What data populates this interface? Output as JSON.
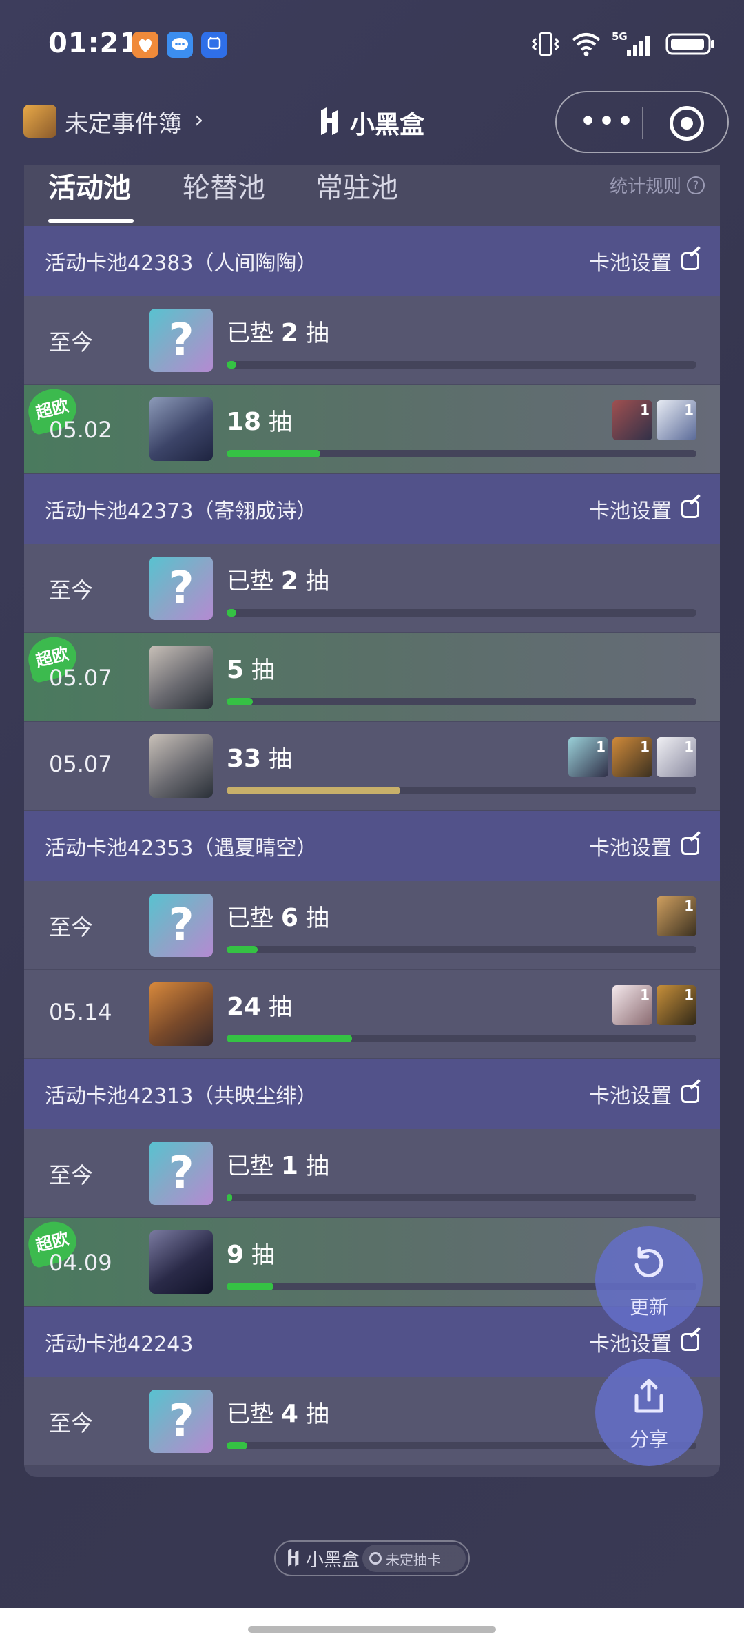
{
  "status_bar": {
    "time": "01:21",
    "network": "5G"
  },
  "nav": {
    "app_name": "未定事件簿",
    "brand": "小黑盒"
  },
  "tabs": [
    {
      "label": "活动池",
      "active": true
    },
    {
      "label": "轮替池",
      "active": false
    },
    {
      "label": "常驻池",
      "active": false
    }
  ],
  "rules_label": "统计规则",
  "pools": [
    {
      "title": "活动卡池42383（人间陶陶）",
      "settings_label": "卡池设置",
      "rows": [
        {
          "date": "至今",
          "prefix": "已垫",
          "count": "2",
          "unit": "抽",
          "lucky": false,
          "progress": 0.02
        },
        {
          "date": "05.02",
          "prefix": "",
          "count": "18",
          "unit": "抽",
          "lucky": true,
          "badge": "超欧",
          "progress": 0.2,
          "minis": [
            "1",
            "1"
          ]
        }
      ]
    },
    {
      "title": "活动卡池42373（寄翎成诗）",
      "settings_label": "卡池设置",
      "rows": [
        {
          "date": "至今",
          "prefix": "已垫",
          "count": "2",
          "unit": "抽",
          "lucky": false,
          "progress": 0.02
        },
        {
          "date": "05.07",
          "prefix": "",
          "count": "5",
          "unit": "抽",
          "lucky": true,
          "badge": "超欧",
          "progress": 0.055
        },
        {
          "date": "05.07",
          "prefix": "",
          "count": "33",
          "unit": "抽",
          "lucky": false,
          "progress": 0.37,
          "gold": true,
          "minis": [
            "1",
            "1",
            "1"
          ]
        }
      ]
    },
    {
      "title": "活动卡池42353（遇夏晴空）",
      "settings_label": "卡池设置",
      "rows": [
        {
          "date": "至今",
          "prefix": "已垫",
          "count": "6",
          "unit": "抽",
          "lucky": false,
          "progress": 0.066,
          "minis": [
            "1"
          ]
        },
        {
          "date": "05.14",
          "prefix": "",
          "count": "24",
          "unit": "抽",
          "lucky": false,
          "progress": 0.267,
          "minis": [
            "1",
            "1"
          ]
        }
      ]
    },
    {
      "title": "活动卡池42313（共映尘绯）",
      "settings_label": "卡池设置",
      "rows": [
        {
          "date": "至今",
          "prefix": "已垫",
          "count": "1",
          "unit": "抽",
          "lucky": false,
          "progress": 0.01
        },
        {
          "date": "04.09",
          "prefix": "",
          "count": "9",
          "unit": "抽",
          "lucky": true,
          "badge": "超欧",
          "progress": 0.1
        }
      ]
    },
    {
      "title": "活动卡池42243",
      "settings_label": "卡池设置",
      "rows": [
        {
          "date": "至今",
          "prefix": "已垫",
          "count": "4",
          "unit": "抽",
          "lucky": false,
          "progress": 0.044
        }
      ]
    }
  ],
  "fab": {
    "refresh_label": "更新",
    "share_label": "分享"
  },
  "footer": {
    "brand": "小黑盒",
    "tag": "未定抽卡"
  },
  "colors": {
    "accent_green": "#35c244",
    "gold": "#c8b06a",
    "header_purple": "#52528a"
  }
}
